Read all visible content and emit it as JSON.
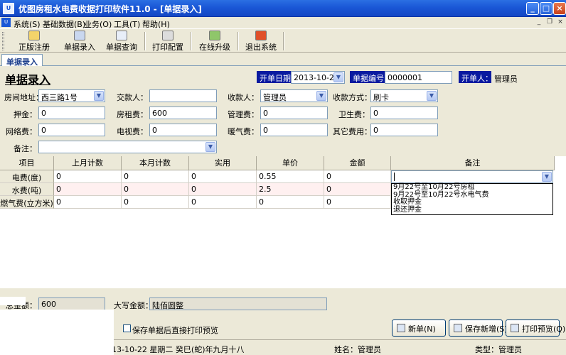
{
  "window": {
    "title": "优图房租水电费收据打印软件11.0 - [单据录入]",
    "app_icon": "U"
  },
  "menu": {
    "items": [
      "系统(S)",
      "基础数据(B)",
      "业务(O)",
      "工具(T)",
      "帮助(H)"
    ],
    "mdi_controls": [
      "_",
      "❐",
      "×"
    ]
  },
  "toolbar": {
    "buttons": [
      "正版注册",
      "单据录入",
      "单据查询",
      "打印配置",
      "在线升级",
      "退出系统"
    ]
  },
  "tabs": [
    "单据录入"
  ],
  "form": {
    "heading": "单据录入",
    "date_label": "开单日期：",
    "date_value": "2013-10-22",
    "receipt_no_label": "单据编号：",
    "receipt_no_value": "0000001",
    "issuer_label": "开单人：",
    "issuer_value": "管理员",
    "address_label": "房间地址：",
    "address_value": "西三路1号",
    "payer_label": "交款人：",
    "payer_value": "",
    "payee_label": "收款人：",
    "payee_value": "管理员",
    "method_label": "收款方式：",
    "method_value": "刷卡",
    "deposit_label": "押金：",
    "deposit_value": "0",
    "rent_label": "房租费：",
    "rent_value": "600",
    "mgmt_label": "管理费：",
    "mgmt_value": "0",
    "sanitation_label": "卫生费：",
    "sanitation_value": "0",
    "network_label": "网络费：",
    "network_value": "0",
    "tv_label": "电视费：",
    "tv_value": "0",
    "heating_label": "暖气费：",
    "heating_value": "0",
    "other_label": "其它费用：",
    "other_value": "0",
    "remark_label": "备注：",
    "remark_value": ""
  },
  "grid": {
    "headers": [
      "项目",
      "上月计数",
      "本月计数",
      "实用",
      "单价",
      "金额",
      "备注"
    ],
    "rows": [
      {
        "item": "电费(度)",
        "prev": "0",
        "curr": "0",
        "used": "0",
        "price": "0.55",
        "amount": "0",
        "note": ""
      },
      {
        "item": "水费(吨)",
        "prev": "0",
        "curr": "0",
        "used": "0",
        "price": "2.5",
        "amount": "0",
        "note": ""
      },
      {
        "item": "燃气费(立方米)",
        "prev": "0",
        "curr": "0",
        "used": "0",
        "price": "0",
        "amount": "0",
        "note": ""
      }
    ],
    "note_options": [
      "9月22号至10月22号房租",
      "9月22号至10月22号水电气费",
      "收取押金",
      "退还押金"
    ]
  },
  "totals": {
    "total_label": "总金额：",
    "total_value": "600",
    "caps_label": "大写金额：",
    "caps_value": "陆佰圆整"
  },
  "options": {
    "preview_after_save": "保存单据后直接打印预览"
  },
  "actions": {
    "new": "新单(N)",
    "save_new": "保存新增(S)",
    "print_preview": "打印预览(Q)"
  },
  "status": {
    "date_text": "日期：2013-10-22 星期二 癸巳(蛇)年九月十八",
    "user_text": "姓名：管理员",
    "type_text": "类型：管理员"
  },
  "colors": {
    "title_blue": "#1a57d6",
    "label_navy": "#0a1aa0",
    "panel_bg": "#ece9d8",
    "row_pink": "#fff0f0"
  }
}
